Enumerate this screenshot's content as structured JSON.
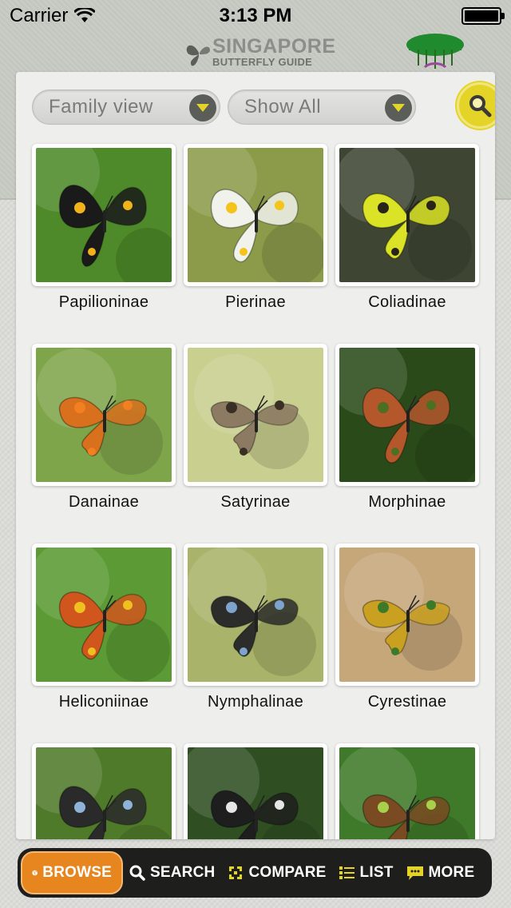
{
  "status_bar": {
    "carrier": "Carrier",
    "time": "3:13 PM"
  },
  "header": {
    "logo_title": "SINGAPORE",
    "logo_subtitle": "BUTTERFLY GUIDE"
  },
  "filters": {
    "view_select": "Family view",
    "show_select": "Show All"
  },
  "grid": [
    {
      "label": "Papilioninae",
      "bg": "#4e8a2a",
      "wing": "#1a1a1a",
      "accent": "#f2b21b"
    },
    {
      "label": "Pierinae",
      "bg": "#8c9b4a",
      "wing": "#f2f2ec",
      "accent": "#f4c41a"
    },
    {
      "label": "Coliadinae",
      "bg": "#3e4633",
      "wing": "#dbe326",
      "accent": "#2a2418"
    },
    {
      "label": "Danainae",
      "bg": "#7fa54a",
      "wing": "#d8701e",
      "accent": "#f28020"
    },
    {
      "label": "Satyrinae",
      "bg": "#c8cf8f",
      "wing": "#8c7a62",
      "accent": "#3a2f24"
    },
    {
      "label": "Morphinae",
      "bg": "#2b4a1a",
      "wing": "#b4582c",
      "accent": "#4c6f22"
    },
    {
      "label": "Heliconiinae",
      "bg": "#5b9a34",
      "wing": "#d1561e",
      "accent": "#f0c020"
    },
    {
      "label": "Nymphalinae",
      "bg": "#aab36a",
      "wing": "#2c2c2a",
      "accent": "#7ea3cc"
    },
    {
      "label": "Cyrestinae",
      "bg": "#c6a77a",
      "wing": "#caa020",
      "accent": "#3c7a2a"
    },
    {
      "label": "",
      "bg": "#4f7a2a",
      "wing": "#2a2a2a",
      "accent": "#8fb2d9"
    },
    {
      "label": "",
      "bg": "#2f4f22",
      "wing": "#1e1e1e",
      "accent": "#e6e6e6"
    },
    {
      "label": "",
      "bg": "#3f7a2a",
      "wing": "#7a4a22",
      "accent": "#a8d04a"
    }
  ],
  "tabbar": {
    "tabs": [
      {
        "label": "BROWSE",
        "icon": "globe-icon"
      },
      {
        "label": "SEARCH",
        "icon": "magnifier-icon"
      },
      {
        "label": "COMPARE",
        "icon": "compare-icon"
      },
      {
        "label": "LIST",
        "icon": "list-icon"
      },
      {
        "label": "MORE",
        "icon": "chat-bubble-icon"
      }
    ]
  },
  "colors": {
    "accent": "#e7851f",
    "search_button": "#e5d428",
    "tab_bar": "#1e1e1c"
  }
}
